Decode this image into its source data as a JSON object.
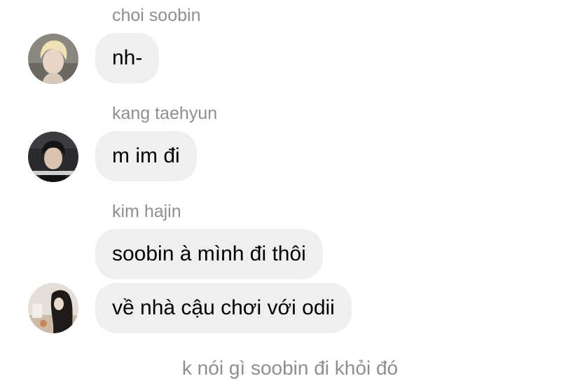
{
  "messages": [
    {
      "sender": "choi soobin",
      "avatar_icon": "user-avatar-blond-hair",
      "bubbles": [
        "nh-"
      ]
    },
    {
      "sender": "kang taehyun",
      "avatar_icon": "user-avatar-dark-hair",
      "bubbles": [
        "m im đi"
      ]
    },
    {
      "sender": "kim hajin",
      "avatar_icon": "user-avatar-long-hair",
      "bubbles": [
        "soobin à mình đi thôi",
        "về nhà cậu chơi với odii"
      ]
    }
  ],
  "footer_note": "k nói gì soobin đi khỏi đó",
  "colors": {
    "bubble_bg": "#efefef",
    "meta_text": "#8e8e93",
    "message_text": "#000000"
  }
}
